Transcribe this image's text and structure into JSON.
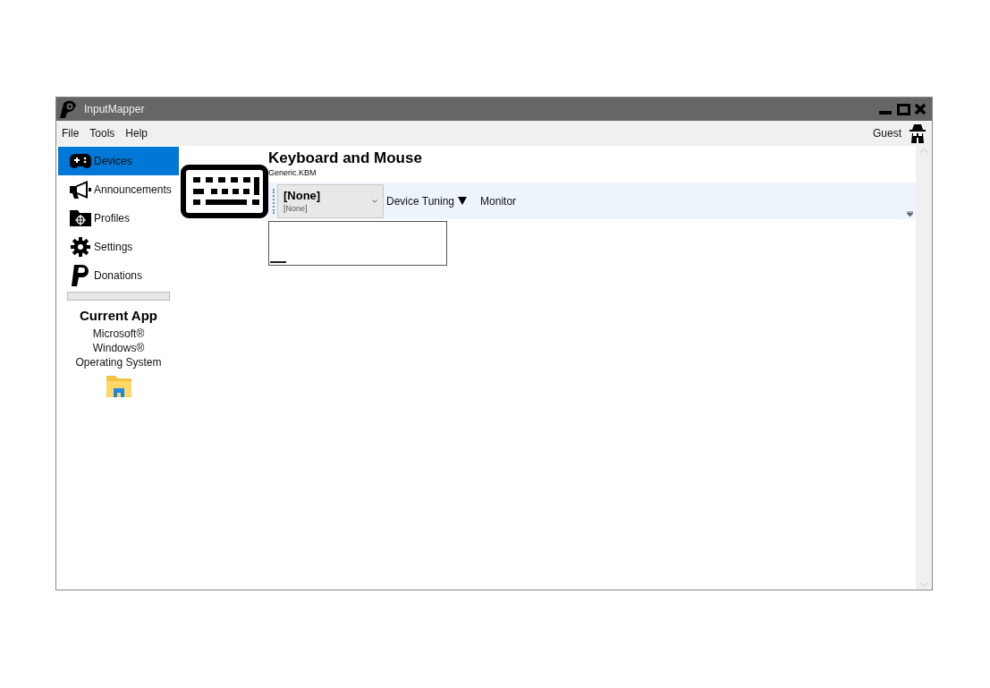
{
  "window": {
    "title": "InputMapper"
  },
  "menu": [
    "File",
    "Tools",
    "Help"
  ],
  "user": {
    "name": "Guest"
  },
  "sidebar": {
    "items": [
      {
        "kind": "gamepad",
        "label": "Devices",
        "selected": true
      },
      {
        "kind": "megaphone",
        "label": "Announcements",
        "selected": false
      },
      {
        "kind": "folder",
        "label": "Profiles",
        "selected": false
      },
      {
        "kind": "gear",
        "label": "Settings",
        "selected": false
      },
      {
        "kind": "paypal",
        "label": "Donations",
        "selected": false
      }
    ],
    "progress": {
      "level": 0
    },
    "current_app": {
      "heading": "Current App",
      "lines": [
        "Microsoft®",
        "Windows®",
        "Operating System"
      ]
    }
  },
  "device": {
    "title": "Keyboard and Mouse",
    "subtitle": "Generic.KBM",
    "profile_dropdown": {
      "value": "[None]",
      "sub": "[None]"
    },
    "toolbar": [
      {
        "label": "Device Tuning",
        "has_menu": true
      },
      {
        "label": "Monitor",
        "has_menu": false
      }
    ]
  }
}
